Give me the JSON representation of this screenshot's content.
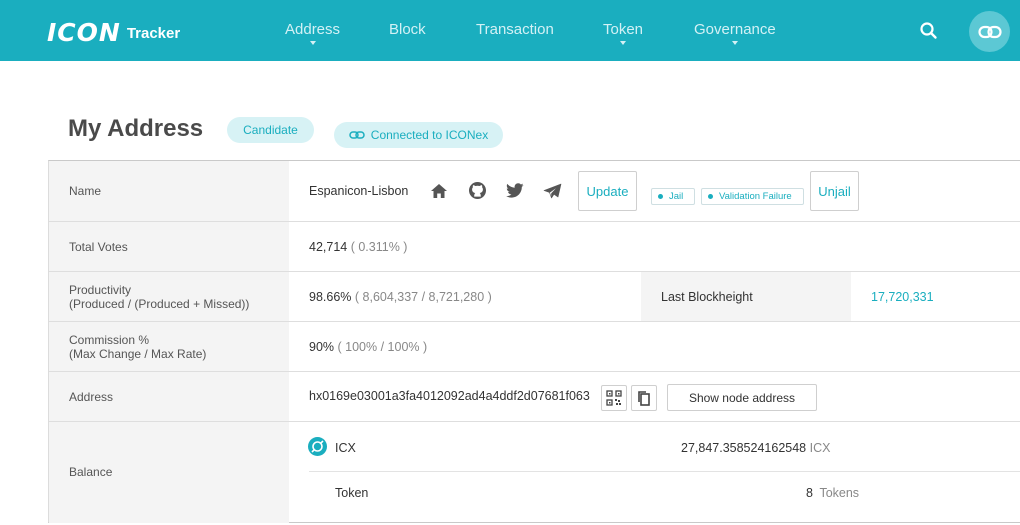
{
  "header": {
    "logo_main": "ICON",
    "logo_sub": "Tracker",
    "nav": [
      {
        "label": "Address",
        "has_dropdown": true
      },
      {
        "label": "Block",
        "has_dropdown": false
      },
      {
        "label": "Transaction",
        "has_dropdown": false
      },
      {
        "label": "Token",
        "has_dropdown": true
      },
      {
        "label": "Governance",
        "has_dropdown": true
      }
    ],
    "accent_color": "#1aaebf"
  },
  "title": {
    "text": "My Address",
    "candidate_badge": "Candidate",
    "connected_badge": "Connected to ICONex"
  },
  "rows": {
    "name": {
      "label": "Name",
      "value": "Espanicon-Lisbon",
      "social_icons": [
        "home-icon",
        "github-icon",
        "twitter-icon",
        "telegram-icon"
      ],
      "update_label": "Update",
      "tags": [
        "Jail",
        "Validation Failure"
      ],
      "unjail_label": "Unjail"
    },
    "total_votes": {
      "label": "Total Votes",
      "value": "42,714",
      "percent": "( 0.311% )"
    },
    "productivity": {
      "label_line1": "Productivity",
      "label_line2": "(Produced / (Produced + Missed))",
      "value": "98.66%",
      "detail": "( 8,604,337 / 8,721,280 )",
      "last_blockheight_label": "Last Blockheight",
      "last_blockheight_value": "17,720,331"
    },
    "commission": {
      "label_line1": "Commission %",
      "label_line2": "(Max Change / Max Rate)",
      "value": "90%",
      "detail": "( 100% / 100% )"
    },
    "address": {
      "label": "Address",
      "value": "hx0169e03001a3fa4012092ad4a4ddf2d07681f063",
      "show_node_label": "Show node address"
    },
    "balance": {
      "label": "Balance",
      "icx_label": "ICX",
      "icx_amount": "27,847.358524162548",
      "icx_unit": "ICX",
      "token_label": "Token",
      "token_count": "8",
      "token_unit": "Tokens"
    }
  }
}
